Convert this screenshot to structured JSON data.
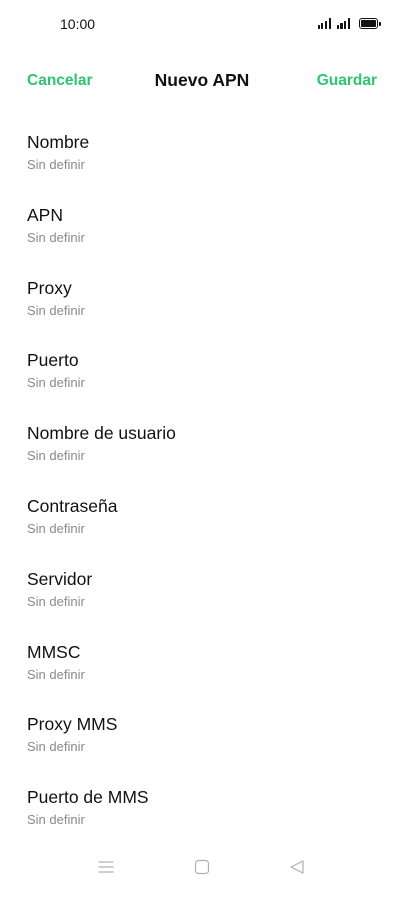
{
  "status_bar": {
    "time": "10:00",
    "icons": [
      "signal-icon",
      "signal-icon",
      "battery-icon"
    ]
  },
  "header": {
    "cancel_label": "Cancelar",
    "title": "Nuevo APN",
    "save_label": "Guardar",
    "accent_color": "#2dc56f"
  },
  "fields": [
    {
      "label": "Nombre",
      "value": "Sin definir"
    },
    {
      "label": "APN",
      "value": "Sin definir"
    },
    {
      "label": "Proxy",
      "value": "Sin definir"
    },
    {
      "label": "Puerto",
      "value": "Sin definir"
    },
    {
      "label": "Nombre de usuario",
      "value": "Sin definir"
    },
    {
      "label": "Contraseña",
      "value": "Sin definir"
    },
    {
      "label": "Servidor",
      "value": "Sin definir"
    },
    {
      "label": "MMSC",
      "value": "Sin definir"
    },
    {
      "label": "Proxy MMS",
      "value": "Sin definir"
    },
    {
      "label": "Puerto de MMS",
      "value": "Sin definir"
    }
  ],
  "nav_bar": {
    "icons": [
      "menu-icon",
      "home-icon",
      "back-icon"
    ]
  }
}
